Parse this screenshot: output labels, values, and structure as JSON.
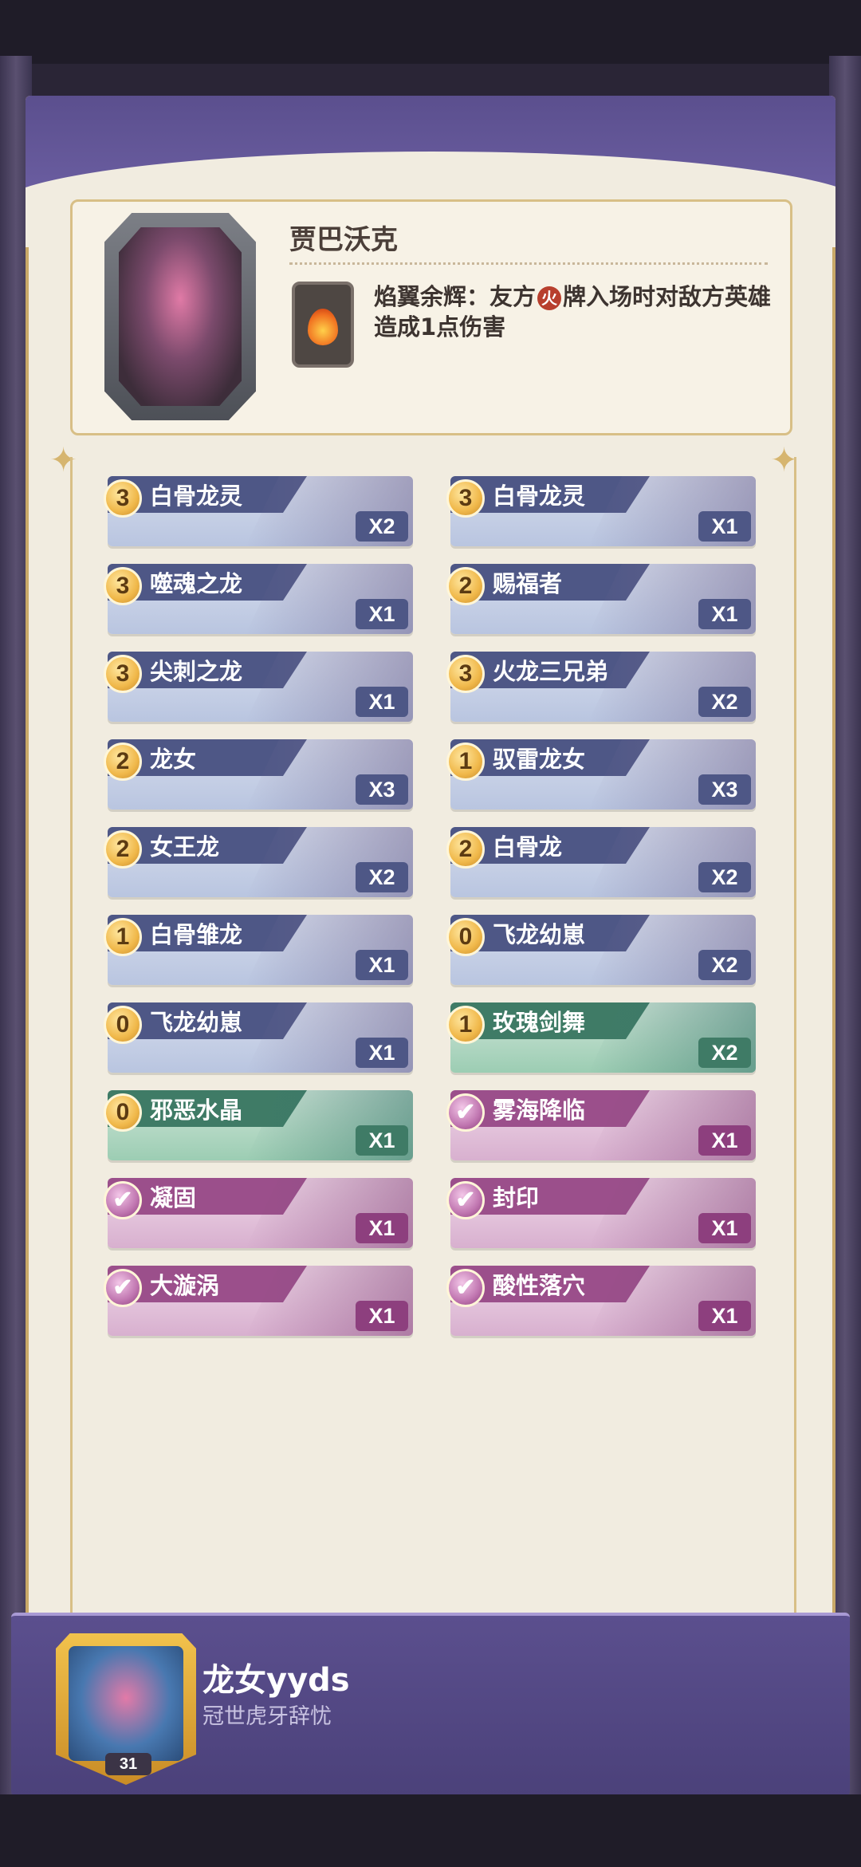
{
  "hero": {
    "name": "贾巴沃克",
    "skill_text_1": "焰翼余辉：友方",
    "skill_fire_symbol": "火",
    "skill_text_2": "牌入场时对敌方英雄造成1点伤害"
  },
  "cards": [
    {
      "cost": "3",
      "name": "白骨龙灵",
      "count": "X2",
      "type": "dragon"
    },
    {
      "cost": "3",
      "name": "白骨龙灵",
      "count": "X1",
      "type": "dragon"
    },
    {
      "cost": "3",
      "name": "噬魂之龙",
      "count": "X1",
      "type": "dragon"
    },
    {
      "cost": "2",
      "name": "赐福者",
      "count": "X1",
      "type": "dragon"
    },
    {
      "cost": "3",
      "name": "尖刺之龙",
      "count": "X1",
      "type": "dragon"
    },
    {
      "cost": "3",
      "name": "火龙三兄弟",
      "count": "X2",
      "type": "dragon"
    },
    {
      "cost": "2",
      "name": "龙女",
      "count": "X3",
      "type": "dragon"
    },
    {
      "cost": "1",
      "name": "驭雷龙女",
      "count": "X3",
      "type": "dragon"
    },
    {
      "cost": "2",
      "name": "女王龙",
      "count": "X2",
      "type": "dragon"
    },
    {
      "cost": "2",
      "name": "白骨龙",
      "count": "X2",
      "type": "dragon"
    },
    {
      "cost": "1",
      "name": "白骨雏龙",
      "count": "X1",
      "type": "dragon"
    },
    {
      "cost": "0",
      "name": "飞龙幼崽",
      "count": "X2",
      "type": "dragon"
    },
    {
      "cost": "0",
      "name": "飞龙幼崽",
      "count": "X1",
      "type": "dragon"
    },
    {
      "cost": "1",
      "name": "玫瑰剑舞",
      "count": "X2",
      "type": "green"
    },
    {
      "cost": "0",
      "name": "邪恶水晶",
      "count": "X1",
      "type": "green"
    },
    {
      "cost": "✔",
      "name": "雾海降临",
      "count": "X1",
      "type": "spell"
    },
    {
      "cost": "✔",
      "name": "凝固",
      "count": "X1",
      "type": "spell"
    },
    {
      "cost": "✔",
      "name": "封印",
      "count": "X1",
      "type": "spell"
    },
    {
      "cost": "✔",
      "name": "大漩涡",
      "count": "X1",
      "type": "spell"
    },
    {
      "cost": "✔",
      "name": "酸性落穴",
      "count": "X1",
      "type": "spell"
    }
  ],
  "player": {
    "name": "龙女yyds",
    "title": "冠世虎牙辞忧",
    "level": "31"
  },
  "colors": {
    "dragon_tab": "#4e5786",
    "green_tab": "#3f7b66",
    "spell_tab": "#9b4f8b",
    "panel_bg": "#f1ece0"
  }
}
